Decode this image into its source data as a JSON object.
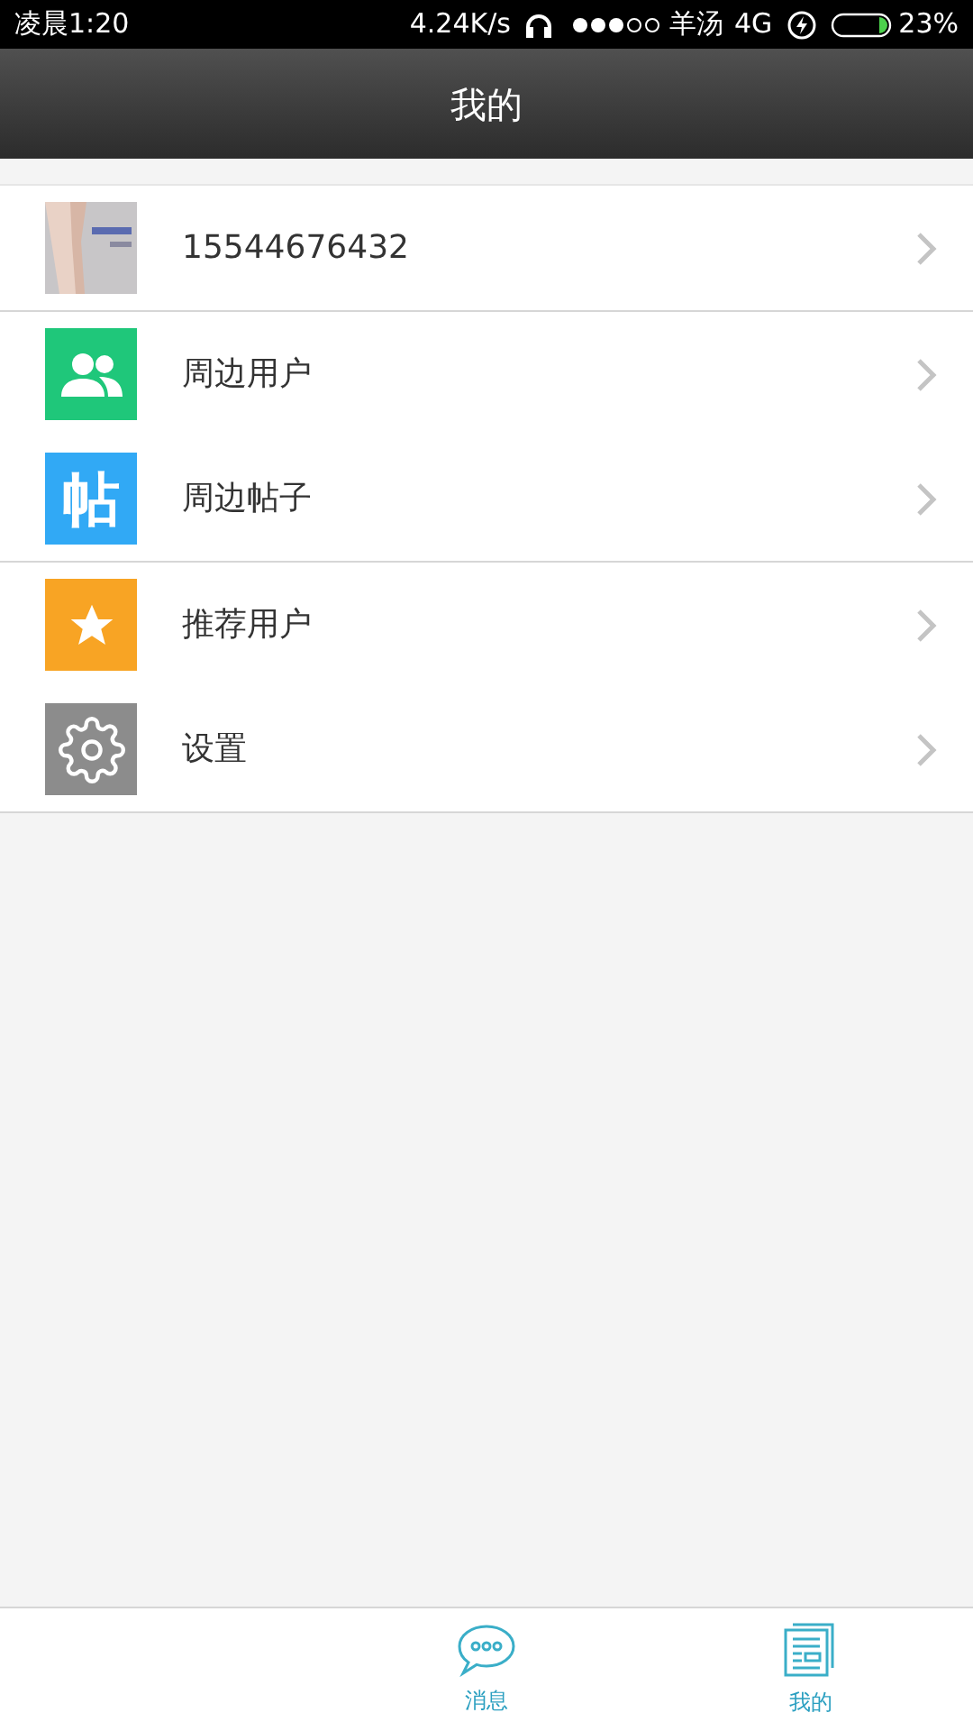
{
  "status_bar": {
    "time": "凌晨1:20",
    "speed": "4.24K/s",
    "carrier": "羊汤",
    "network": "4G",
    "battery": "23%"
  },
  "header": {
    "title": "我的"
  },
  "profile": {
    "phone": "15544676432"
  },
  "groups": [
    [
      {
        "label": "周边用户",
        "kind": "people",
        "color": "#1fc77a"
      },
      {
        "label": "周边帖子",
        "kind": "glyph",
        "icon_text": "帖",
        "color": "#31a9f5"
      }
    ],
    [
      {
        "label": "推荐用户",
        "kind": "star",
        "color": "#f8a424"
      },
      {
        "label": "设置",
        "kind": "gear",
        "color": "#8c8c8c"
      }
    ]
  ],
  "tabs": [
    {
      "label": "消息",
      "kind": "chat"
    },
    {
      "label": "我的",
      "kind": "news"
    }
  ]
}
